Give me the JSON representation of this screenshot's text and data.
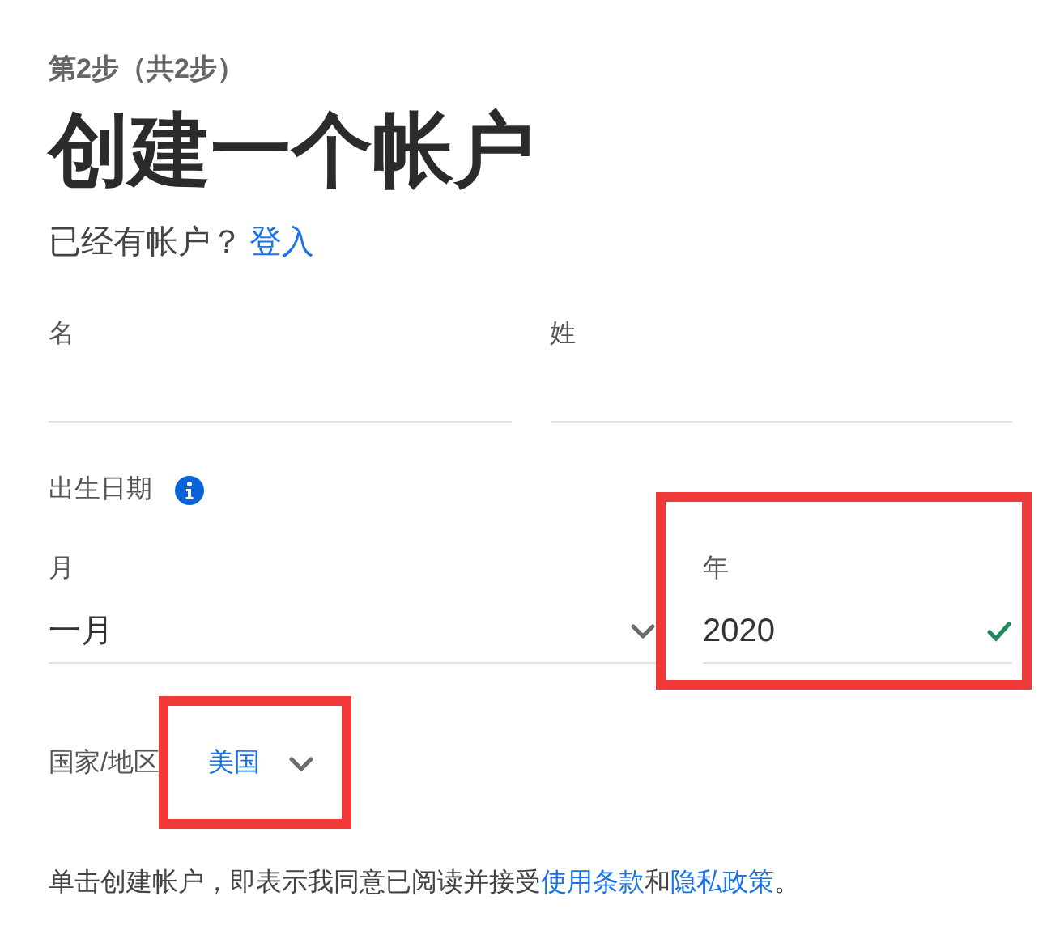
{
  "step": "第2步（共2步）",
  "title": "创建一个帐户",
  "signin": {
    "prompt": "已经有帐户？",
    "link": "登入"
  },
  "name_fields": [
    {
      "label": "名"
    },
    {
      "label": "姓"
    }
  ],
  "birthdate": {
    "label": "出生日期",
    "month": {
      "label": "月",
      "value": "一月"
    },
    "year": {
      "label": "年",
      "value": "2020",
      "valid": true,
      "highlighted": true
    }
  },
  "country": {
    "label": "国家/地区",
    "value": "美国",
    "highlighted": true
  },
  "terms": {
    "prefix": "单击创建帐户，即表示我同意已阅读并接受",
    "link_1": "使用条款",
    "middle": "和",
    "link_2": "隐私政策",
    "suffix": "。"
  }
}
